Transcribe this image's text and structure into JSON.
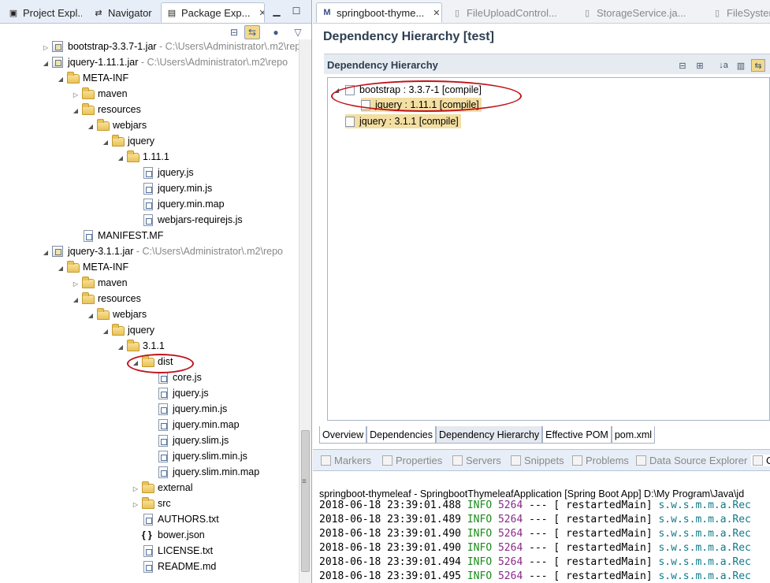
{
  "left_panel": {
    "tabs": [
      {
        "label": "Project Expl...",
        "icon": "project-explorer-icon"
      },
      {
        "label": "Navigator",
        "icon": "navigator-icon"
      },
      {
        "label": "Package Exp...",
        "icon": "package-explorer-icon",
        "close": "✕"
      }
    ],
    "tree": [
      {
        "label": "bootstrap-3.3.7-1.jar",
        "suffix": " - C:\\Users\\Administrator\\.m2\\repo",
        "icon": "jar",
        "depth": 0,
        "twisty": "collapsed"
      },
      {
        "label": "jquery-1.11.1.jar",
        "suffix": " - C:\\Users\\Administrator\\.m2\\repo",
        "icon": "jar",
        "depth": 0,
        "twisty": "expanded"
      },
      {
        "label": "META-INF",
        "icon": "folder",
        "depth": 1,
        "twisty": "expanded"
      },
      {
        "label": "maven",
        "icon": "folder",
        "depth": 2,
        "twisty": "collapsed"
      },
      {
        "label": "resources",
        "icon": "folder",
        "depth": 2,
        "twisty": "expanded"
      },
      {
        "label": "webjars",
        "icon": "folder",
        "depth": 3,
        "twisty": "expanded"
      },
      {
        "label": "jquery",
        "icon": "folder",
        "depth": 4,
        "twisty": "expanded"
      },
      {
        "label": "1.11.1",
        "icon": "folder",
        "depth": 5,
        "twisty": "expanded"
      },
      {
        "label": "jquery.js",
        "icon": "file",
        "depth": 6,
        "twisty": "none"
      },
      {
        "label": "jquery.min.js",
        "icon": "file",
        "depth": 6,
        "twisty": "none"
      },
      {
        "label": "jquery.min.map",
        "icon": "file",
        "depth": 6,
        "twisty": "none"
      },
      {
        "label": "webjars-requirejs.js",
        "icon": "file",
        "depth": 6,
        "twisty": "none"
      },
      {
        "label": "MANIFEST.MF",
        "icon": "file",
        "depth": 2,
        "twisty": "none"
      },
      {
        "label": "jquery-3.1.1.jar",
        "suffix": " - C:\\Users\\Administrator\\.m2\\repo",
        "icon": "jar",
        "depth": 0,
        "twisty": "expanded"
      },
      {
        "label": "META-INF",
        "icon": "folder",
        "depth": 1,
        "twisty": "expanded"
      },
      {
        "label": "maven",
        "icon": "folder",
        "depth": 2,
        "twisty": "collapsed"
      },
      {
        "label": "resources",
        "icon": "folder",
        "depth": 2,
        "twisty": "expanded"
      },
      {
        "label": "webjars",
        "icon": "folder",
        "depth": 3,
        "twisty": "expanded"
      },
      {
        "label": "jquery",
        "icon": "folder",
        "depth": 4,
        "twisty": "expanded"
      },
      {
        "label": "3.1.1",
        "icon": "folder",
        "depth": 5,
        "twisty": "expanded"
      },
      {
        "label": "dist",
        "icon": "folder",
        "depth": 6,
        "twisty": "expanded"
      },
      {
        "label": "core.js",
        "icon": "file",
        "depth": 7,
        "twisty": "none"
      },
      {
        "label": "jquery.js",
        "icon": "file",
        "depth": 7,
        "twisty": "none"
      },
      {
        "label": "jquery.min.js",
        "icon": "file",
        "depth": 7,
        "twisty": "none"
      },
      {
        "label": "jquery.min.map",
        "icon": "file",
        "depth": 7,
        "twisty": "none"
      },
      {
        "label": "jquery.slim.js",
        "icon": "file",
        "depth": 7,
        "twisty": "none"
      },
      {
        "label": "jquery.slim.min.js",
        "icon": "file",
        "depth": 7,
        "twisty": "none"
      },
      {
        "label": "jquery.slim.min.map",
        "icon": "file",
        "depth": 7,
        "twisty": "none"
      },
      {
        "label": "external",
        "icon": "folder",
        "depth": 6,
        "twisty": "collapsed"
      },
      {
        "label": "src",
        "icon": "folder",
        "depth": 6,
        "twisty": "collapsed"
      },
      {
        "label": "AUTHORS.txt",
        "icon": "file",
        "depth": 6,
        "twisty": "none"
      },
      {
        "label": "bower.json",
        "icon": "json",
        "depth": 6,
        "twisty": "none"
      },
      {
        "label": "LICENSE.txt",
        "icon": "file",
        "depth": 6,
        "twisty": "none"
      },
      {
        "label": "README.md",
        "icon": "file",
        "depth": 6,
        "twisty": "none"
      }
    ]
  },
  "editor": {
    "tabs": [
      {
        "label": "springboot-thyme...",
        "icon": "maven-pom-icon",
        "close": "✕",
        "active": true
      },
      {
        "label": "FileUploadControl...",
        "icon": "java-file-icon"
      },
      {
        "label": "StorageService.ja...",
        "icon": "java-file-icon"
      },
      {
        "label": "FileSystemS",
        "icon": "java-file-icon"
      }
    ],
    "page_title": "Dependency Hierarchy [test]",
    "section_title": "Dependency Hierarchy",
    "dependencies": [
      {
        "label": "bootstrap : 3.3.7-1 [compile]",
        "level": 0,
        "highlight": false,
        "twisty": "expanded"
      },
      {
        "label": "jquery : 1.11.1 [compile]",
        "level": 1,
        "highlight": true,
        "twisty": "none"
      },
      {
        "label": "jquery : 3.1.1 [compile]",
        "level": 0,
        "highlight": true,
        "twisty": "none"
      }
    ],
    "page_tabs": [
      "Overview",
      "Dependencies",
      "Dependency Hierarchy",
      "Effective POM",
      "pom.xml"
    ],
    "active_page_tab": 2
  },
  "bottom_panel": {
    "tabs": [
      {
        "label": "Markers",
        "icon": "markers-icon"
      },
      {
        "label": "Properties",
        "icon": "properties-icon"
      },
      {
        "label": "Servers",
        "icon": "servers-icon"
      },
      {
        "label": "Snippets",
        "icon": "snippets-icon"
      },
      {
        "label": "Problems",
        "icon": "problems-icon"
      },
      {
        "label": "Data Source Explorer",
        "icon": "data-source-icon"
      },
      {
        "label": "C",
        "icon": "console-icon"
      }
    ],
    "console_header": "springboot-thymeleaf - SpringbootThymeleafApplication [Spring Boot App] D:\\My Program\\Java\\jd",
    "log": [
      {
        "ts": "2018-06-18 23:39:01.488",
        "level": "INFO",
        "pid": "5264",
        "sep": "--- [",
        "thread": "restartedMain]",
        "cls": "s.w.s.m.m.a.Rec"
      },
      {
        "ts": "2018-06-18 23:39:01.489",
        "level": "INFO",
        "pid": "5264",
        "sep": "--- [",
        "thread": "restartedMain]",
        "cls": "s.w.s.m.m.a.Rec"
      },
      {
        "ts": "2018-06-18 23:39:01.490",
        "level": "INFO",
        "pid": "5264",
        "sep": "--- [",
        "thread": "restartedMain]",
        "cls": "s.w.s.m.m.a.Rec"
      },
      {
        "ts": "2018-06-18 23:39:01.490",
        "level": "INFO",
        "pid": "5264",
        "sep": "--- [",
        "thread": "restartedMain]",
        "cls": "s.w.s.m.m.a.Rec"
      },
      {
        "ts": "2018-06-18 23:39:01.494",
        "level": "INFO",
        "pid": "5264",
        "sep": "--- [",
        "thread": "restartedMain]",
        "cls": "s.w.s.m.m.a.Rec"
      },
      {
        "ts": "2018-06-18 23:39:01.495",
        "level": "INFO",
        "pid": "5264",
        "sep": "--- [",
        "thread": "restartedMain]",
        "cls": "s.w.s.m.m.a.Rec"
      }
    ]
  },
  "colors": {
    "highlight": "#f4dfa2",
    "annotation": "#c0141b",
    "info": "#1a8c1a",
    "pid": "#8a2a8a",
    "logger": "#0e7a8a"
  }
}
